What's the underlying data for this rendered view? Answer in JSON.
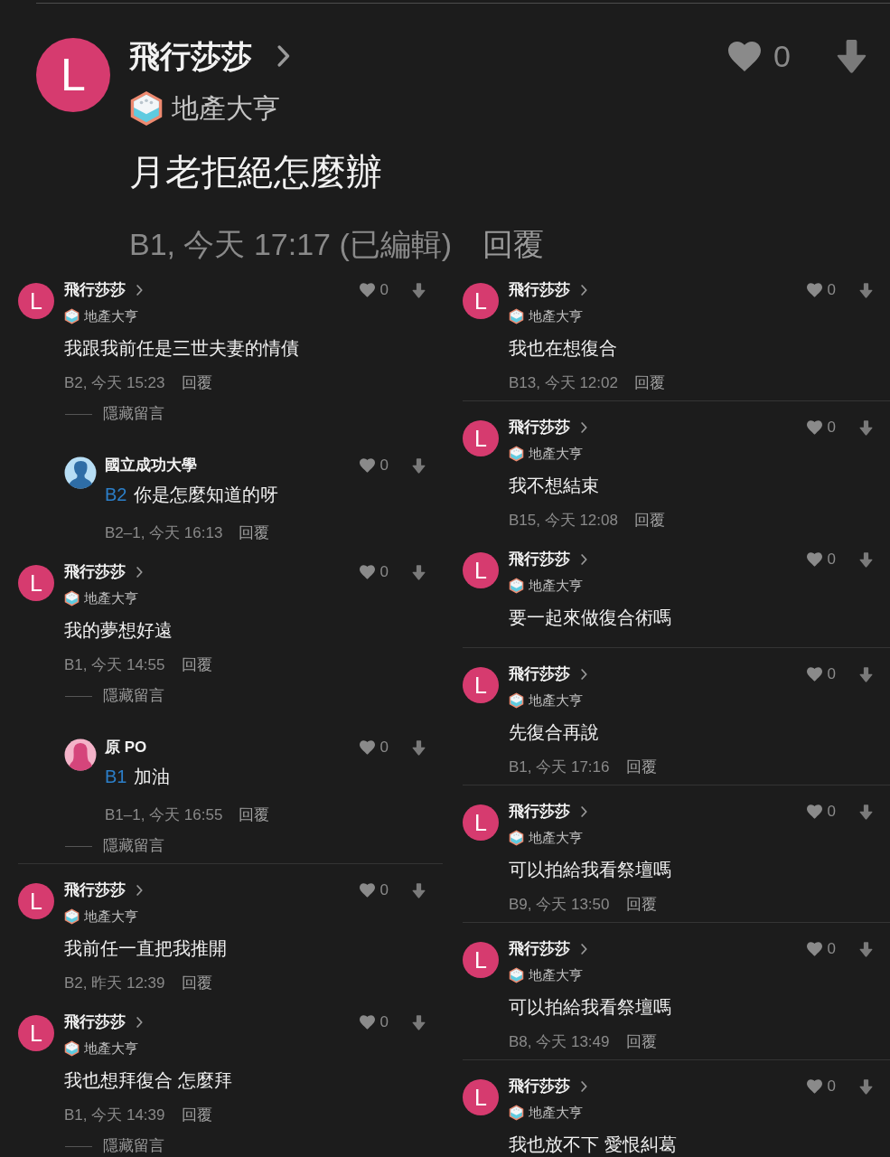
{
  "post": {
    "avatar": {
      "kind": "letter",
      "letter": "L"
    },
    "author": "飛行莎莎",
    "title": "地產大亨",
    "text": "月老拒絕怎麼辦",
    "meta": "B1, 今天 17:17 (已編輯)",
    "reply": "回覆",
    "likes": "0"
  },
  "columns": [
    {
      "sections": [
        {
          "comments": [
            {
              "avatar": {
                "kind": "letter",
                "letter": "L"
              },
              "author": "飛行莎莎",
              "title": "地產大亨",
              "text": "我跟我前任是三世夫妻的情債",
              "meta": "B2, 今天 15:23",
              "reply": "回覆",
              "likes": "0",
              "hide": "隱藏留言",
              "replies": [
                {
                  "avatar": {
                    "kind": "male"
                  },
                  "author": "國立成功大學",
                  "mention": "B2",
                  "text": "你是怎麼知道的呀",
                  "meta": "B2–1, 今天 16:13",
                  "reply": "回覆",
                  "likes": "0"
                }
              ]
            },
            {
              "avatar": {
                "kind": "letter",
                "letter": "L"
              },
              "author": "飛行莎莎",
              "title": "地產大亨",
              "text": "我的夢想好遠",
              "meta": "B1, 今天 14:55",
              "reply": "回覆",
              "likes": "0",
              "hide": "隱藏留言",
              "replies": [
                {
                  "avatar": {
                    "kind": "female"
                  },
                  "author": "原 PO",
                  "mention": "B1",
                  "text": "加油",
                  "meta": "B1–1, 今天 16:55",
                  "reply": "回覆",
                  "likes": "0",
                  "hide": "隱藏留言"
                }
              ]
            }
          ]
        },
        {
          "comments": [
            {
              "avatar": {
                "kind": "letter",
                "letter": "L"
              },
              "author": "飛行莎莎",
              "title": "地產大亨",
              "text": "我前任一直把我推開",
              "meta": "B2, 昨天 12:39",
              "reply": "回覆",
              "likes": "0"
            },
            {
              "avatar": {
                "kind": "letter",
                "letter": "L"
              },
              "author": "飛行莎莎",
              "title": "地產大亨",
              "text": "我也想拜復合 怎麼拜",
              "meta": "B1, 今天 14:39",
              "reply": "回覆",
              "likes": "0",
              "hide": "隱藏留言"
            }
          ]
        }
      ]
    },
    {
      "sections": [
        {
          "comments": [
            {
              "avatar": {
                "kind": "letter",
                "letter": "L"
              },
              "author": "飛行莎莎",
              "title": "地產大亨",
              "text": "我也在想復合",
              "meta": "B13, 今天 12:02",
              "reply": "回覆",
              "likes": "0"
            }
          ]
        },
        {
          "comments": [
            {
              "avatar": {
                "kind": "letter",
                "letter": "L"
              },
              "author": "飛行莎莎",
              "title": "地產大亨",
              "text": "我不想結束",
              "meta": "B15, 今天 12:08",
              "reply": "回覆",
              "likes": "0"
            },
            {
              "avatar": {
                "kind": "letter",
                "letter": "L"
              },
              "author": "飛行莎莎",
              "title": "地產大亨",
              "text": "要一起來做復合術嗎",
              "likes": "0"
            }
          ]
        },
        {
          "comments": [
            {
              "avatar": {
                "kind": "letter",
                "letter": "L"
              },
              "author": "飛行莎莎",
              "title": "地產大亨",
              "text": "先復合再說",
              "meta": "B1, 今天 17:16",
              "reply": "回覆",
              "likes": "0"
            }
          ]
        },
        {
          "comments": [
            {
              "avatar": {
                "kind": "letter",
                "letter": "L"
              },
              "author": "飛行莎莎",
              "title": "地產大亨",
              "text": "可以拍給我看祭壇嗎",
              "meta": "B9, 今天 13:50",
              "reply": "回覆",
              "likes": "0"
            }
          ]
        },
        {
          "comments": [
            {
              "avatar": {
                "kind": "letter",
                "letter": "L"
              },
              "author": "飛行莎莎",
              "title": "地產大亨",
              "text": "可以拍給我看祭壇嗎",
              "meta": "B8, 今天 13:49",
              "reply": "回覆",
              "likes": "0"
            }
          ]
        },
        {
          "comments": [
            {
              "avatar": {
                "kind": "letter",
                "letter": "L"
              },
              "author": "飛行莎莎",
              "title": "地產大亨",
              "text": "我也放不下 愛恨糾葛",
              "likes": "0"
            }
          ]
        }
      ]
    }
  ]
}
